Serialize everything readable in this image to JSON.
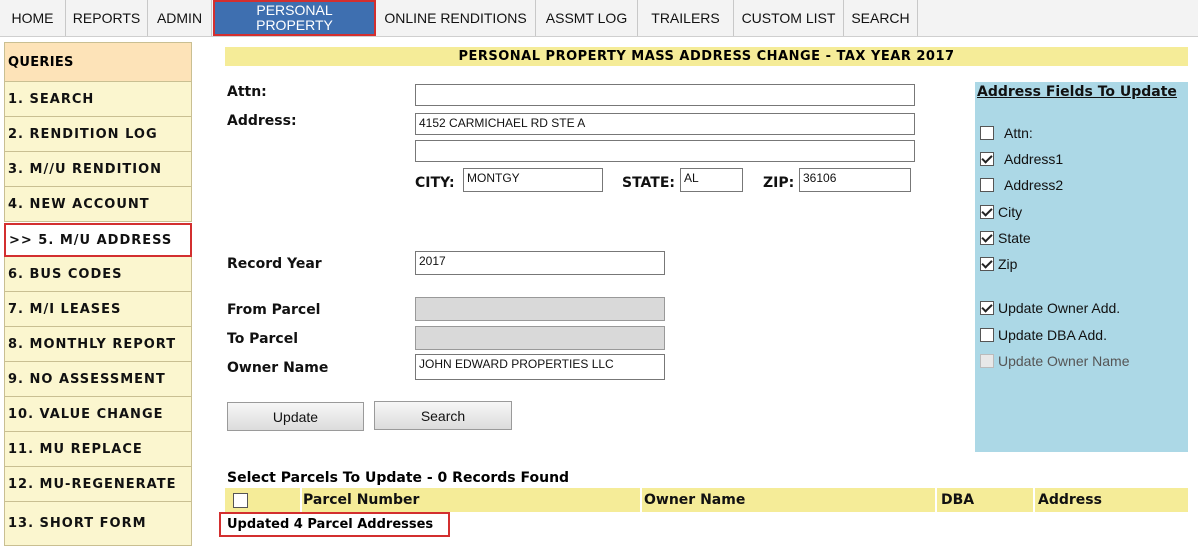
{
  "nav": {
    "tabs": [
      {
        "label": "HOME"
      },
      {
        "label": "REPORTS"
      },
      {
        "label": "ADMIN"
      },
      {
        "label": "PERSONAL PROPERTY"
      },
      {
        "label": "ONLINE RENDITIONS"
      },
      {
        "label": "ASSMT LOG"
      },
      {
        "label": "TRAILERS"
      },
      {
        "label": "CUSTOM LIST"
      },
      {
        "label": "SEARCH"
      }
    ],
    "active_tab": "PERSONAL PROPERTY"
  },
  "sidebar": {
    "header": "QUERIES",
    "items": [
      {
        "label": "1. SEARCH"
      },
      {
        "label": "2. RENDITION LOG"
      },
      {
        "label": "3. M//U RENDITION"
      },
      {
        "label": "4. NEW ACCOUNT"
      },
      {
        "label": ">> 5. M/U ADDRESS"
      },
      {
        "label": "6. BUS CODES"
      },
      {
        "label": "7. M/I LEASES"
      },
      {
        "label": "8. MONTHLY REPORT"
      },
      {
        "label": "9. NO ASSESSMENT"
      },
      {
        "label": "10. VALUE CHANGE"
      },
      {
        "label": "11. MU REPLACE"
      },
      {
        "label": "12. MU-REGENERATE"
      },
      {
        "label": "13. SHORT FORM"
      }
    ]
  },
  "page_title": "PERSONAL PROPERTY MASS ADDRESS CHANGE - TAX YEAR 2017",
  "form": {
    "attn_label": "Attn:",
    "attn_value": "",
    "address_label": "Address:",
    "address1_value": "4152 CARMICHAEL RD STE A",
    "address2_value": "",
    "city_label": "CITY:",
    "city_value": "MONTGY",
    "state_label": "STATE:",
    "state_value": "AL",
    "zip_label": "ZIP:",
    "zip_value": "36106",
    "record_year_label": "Record Year",
    "record_year_value": "2017",
    "from_parcel_label": "From Parcel",
    "from_parcel_value": "",
    "to_parcel_label": "To Parcel",
    "to_parcel_value": "",
    "owner_name_label": "Owner Name",
    "owner_name_value": "JOHN EDWARD PROPERTIES LLC",
    "update_button": "Update",
    "search_button": "Search"
  },
  "fields_panel": {
    "title": "Address Fields To Update",
    "fields": [
      {
        "label": "Attn:",
        "checked": false
      },
      {
        "label": "Address1",
        "checked": true
      },
      {
        "label": "Address2",
        "checked": false
      },
      {
        "label": "City",
        "checked": true
      },
      {
        "label": "State",
        "checked": true
      },
      {
        "label": "Zip",
        "checked": true
      }
    ],
    "options": [
      {
        "label": "Update Owner Add.",
        "checked": true,
        "disabled": false
      },
      {
        "label": "Update DBA Add.",
        "checked": false,
        "disabled": false
      },
      {
        "label": "Update Owner Name",
        "checked": false,
        "disabled": true
      }
    ]
  },
  "results": {
    "heading": "Select Parcels To Update -  0 Records Found",
    "columns": [
      "Parcel Number",
      "Owner Name",
      "DBA",
      "Address"
    ],
    "status": "Updated 4 Parcel Addresses"
  }
}
